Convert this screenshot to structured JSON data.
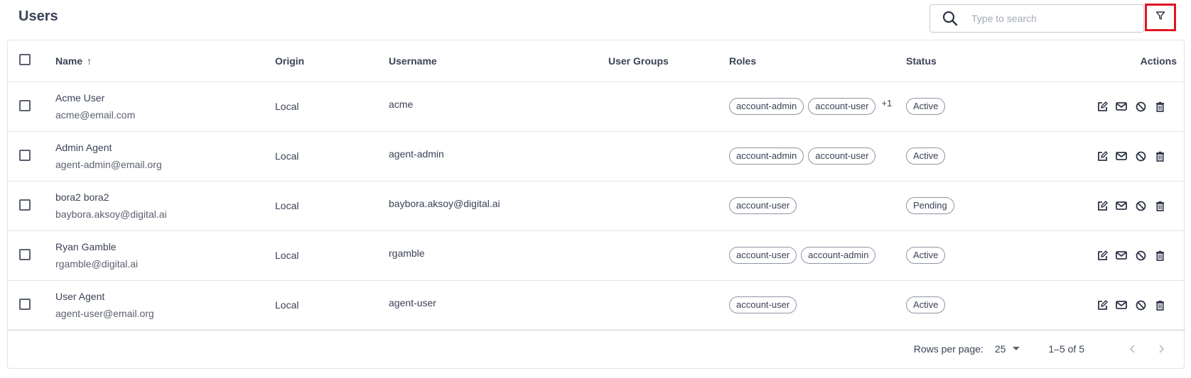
{
  "header": {
    "title": "Users",
    "search": {
      "placeholder": "Type to search",
      "value": "",
      "icon": "search-icon"
    },
    "filter_button": {
      "icon": "filter-icon",
      "highlight_color": "#e0161f"
    }
  },
  "table": {
    "columns": [
      {
        "key": "select",
        "label": ""
      },
      {
        "key": "name",
        "label": "Name",
        "sort": "ascending"
      },
      {
        "key": "origin",
        "label": "Origin"
      },
      {
        "key": "username",
        "label": "Username"
      },
      {
        "key": "user_groups",
        "label": "User Groups"
      },
      {
        "key": "roles",
        "label": "Roles"
      },
      {
        "key": "status",
        "label": "Status"
      },
      {
        "key": "actions",
        "label": "Actions"
      }
    ],
    "rows": [
      {
        "name": "Acme User",
        "email": "acme@email.com",
        "origin": "Local",
        "username": "acme",
        "user_groups": "",
        "roles": [
          "account-admin",
          "account-user"
        ],
        "roles_more": "+1",
        "status": "Active"
      },
      {
        "name": "Admin Agent",
        "email": "agent-admin@email.org",
        "origin": "Local",
        "username": "agent-admin",
        "user_groups": "",
        "roles": [
          "account-admin",
          "account-user"
        ],
        "roles_more": "",
        "status": "Active"
      },
      {
        "name": "bora2 bora2",
        "email": "baybora.aksoy@digital.ai",
        "origin": "Local",
        "username": "baybora.aksoy@digital.ai",
        "user_groups": "",
        "roles": [
          "account-user"
        ],
        "roles_more": "",
        "status": "Pending"
      },
      {
        "name": "Ryan Gamble",
        "email": "rgamble@digital.ai",
        "origin": "Local",
        "username": "rgamble",
        "user_groups": "",
        "roles": [
          "account-user",
          "account-admin"
        ],
        "roles_more": "",
        "status": "Active"
      },
      {
        "name": "User Agent",
        "email": "agent-user@email.org",
        "origin": "Local",
        "username": "agent-user",
        "user_groups": "",
        "roles": [
          "account-user"
        ],
        "roles_more": "",
        "status": "Active"
      }
    ],
    "row_actions": [
      "edit-icon",
      "mail-icon",
      "block-icon",
      "delete-icon"
    ]
  },
  "pagination": {
    "rows_per_page_label": "Rows per page:",
    "rows_per_page": "25",
    "range": "1–5 of 5",
    "prev_icon": "chevron-left-icon",
    "next_icon": "chevron-right-icon"
  }
}
